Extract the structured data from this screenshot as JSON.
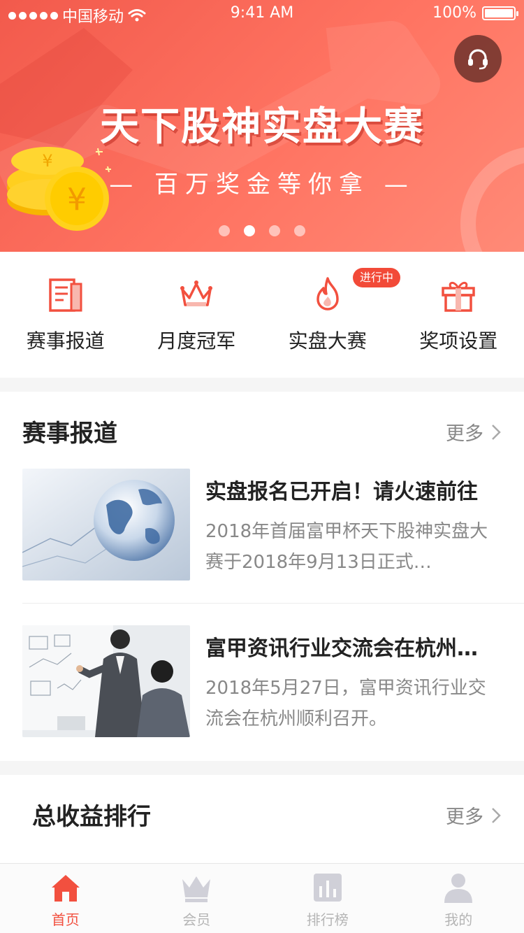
{
  "status_bar": {
    "carrier": "中国移动",
    "time": "9:41 AM",
    "battery": "100%"
  },
  "banner": {
    "title": "天下股神实盘大赛",
    "subtitle": "— 百万奖金等你拿 —",
    "active_slide": 2,
    "slide_count": 4,
    "support_icon": "headset-icon"
  },
  "quick_nav": [
    {
      "label": "赛事报道",
      "icon": "document-icon"
    },
    {
      "label": "月度冠军",
      "icon": "crown-icon"
    },
    {
      "label": "实盘大赛",
      "icon": "flame-icon",
      "badge": "进行中"
    },
    {
      "label": "奖项设置",
      "icon": "gift-icon"
    }
  ],
  "news_section": {
    "title": "赛事报道",
    "more": "更多",
    "items": [
      {
        "title": "实盘报名已开启！请火速前往",
        "desc": "2018年首届富甲杯天下股神实盘大赛于2018年9月13日正式…",
        "thumb": "globe-image"
      },
      {
        "title": "富甲资讯行业交流会在杭州…",
        "desc": "2018年5月27日，富甲资讯行业交流会在杭州顺利召开。",
        "thumb": "presentation-image"
      }
    ]
  },
  "ranking_section": {
    "title": "总收益排行",
    "more": "更多"
  },
  "tab_bar": [
    {
      "label": "首页",
      "icon": "home-icon",
      "active": true
    },
    {
      "label": "会员",
      "icon": "crown-icon",
      "active": false
    },
    {
      "label": "排行榜",
      "icon": "bar-chart-icon",
      "active": false
    },
    {
      "label": "我的",
      "icon": "person-icon",
      "active": false
    }
  ],
  "colors": {
    "accent": "#f2503f",
    "banner": "#ff7462",
    "text_primary": "#222222",
    "text_secondary": "#888888"
  }
}
